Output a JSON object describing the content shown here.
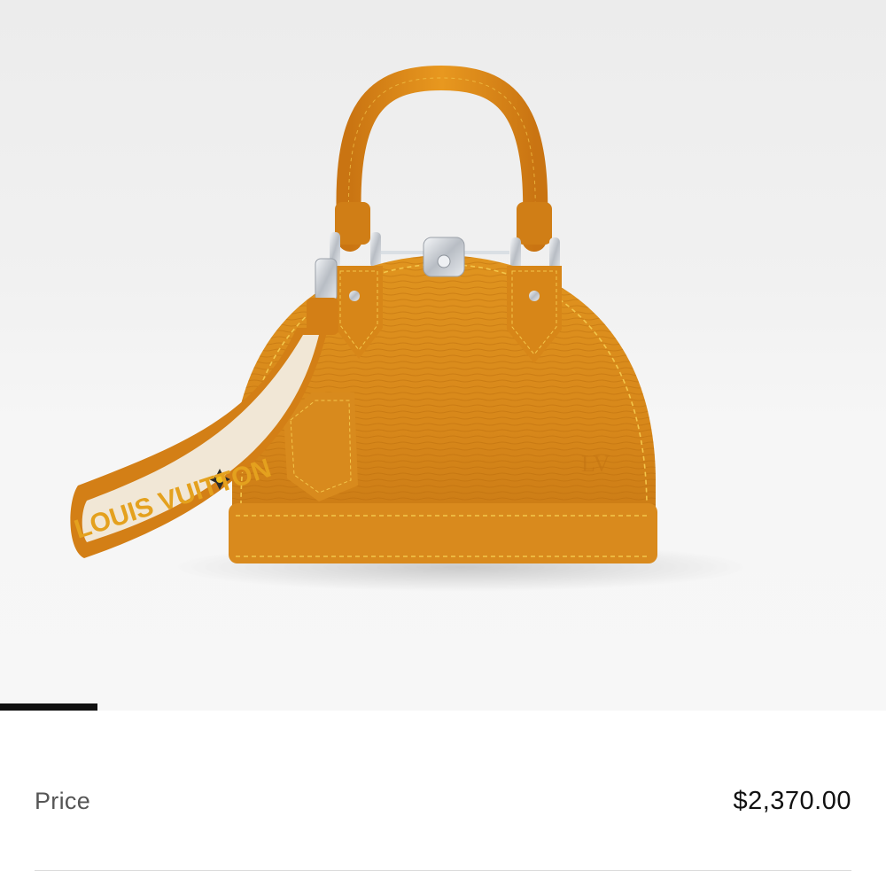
{
  "gallery": {
    "image_subject": "product-photo-handbag",
    "strap_text": "LOUIS VUITTON",
    "progress_fraction": 0.11
  },
  "price": {
    "label": "Price",
    "value": "$2,370.00"
  },
  "colors": {
    "leather": "#d88a1f",
    "leather_dark": "#b86d10",
    "stitching": "#f3c64a",
    "hardware": "#c9cdd3",
    "strap_cream": "#f1e7d6",
    "progress": "#111111"
  }
}
